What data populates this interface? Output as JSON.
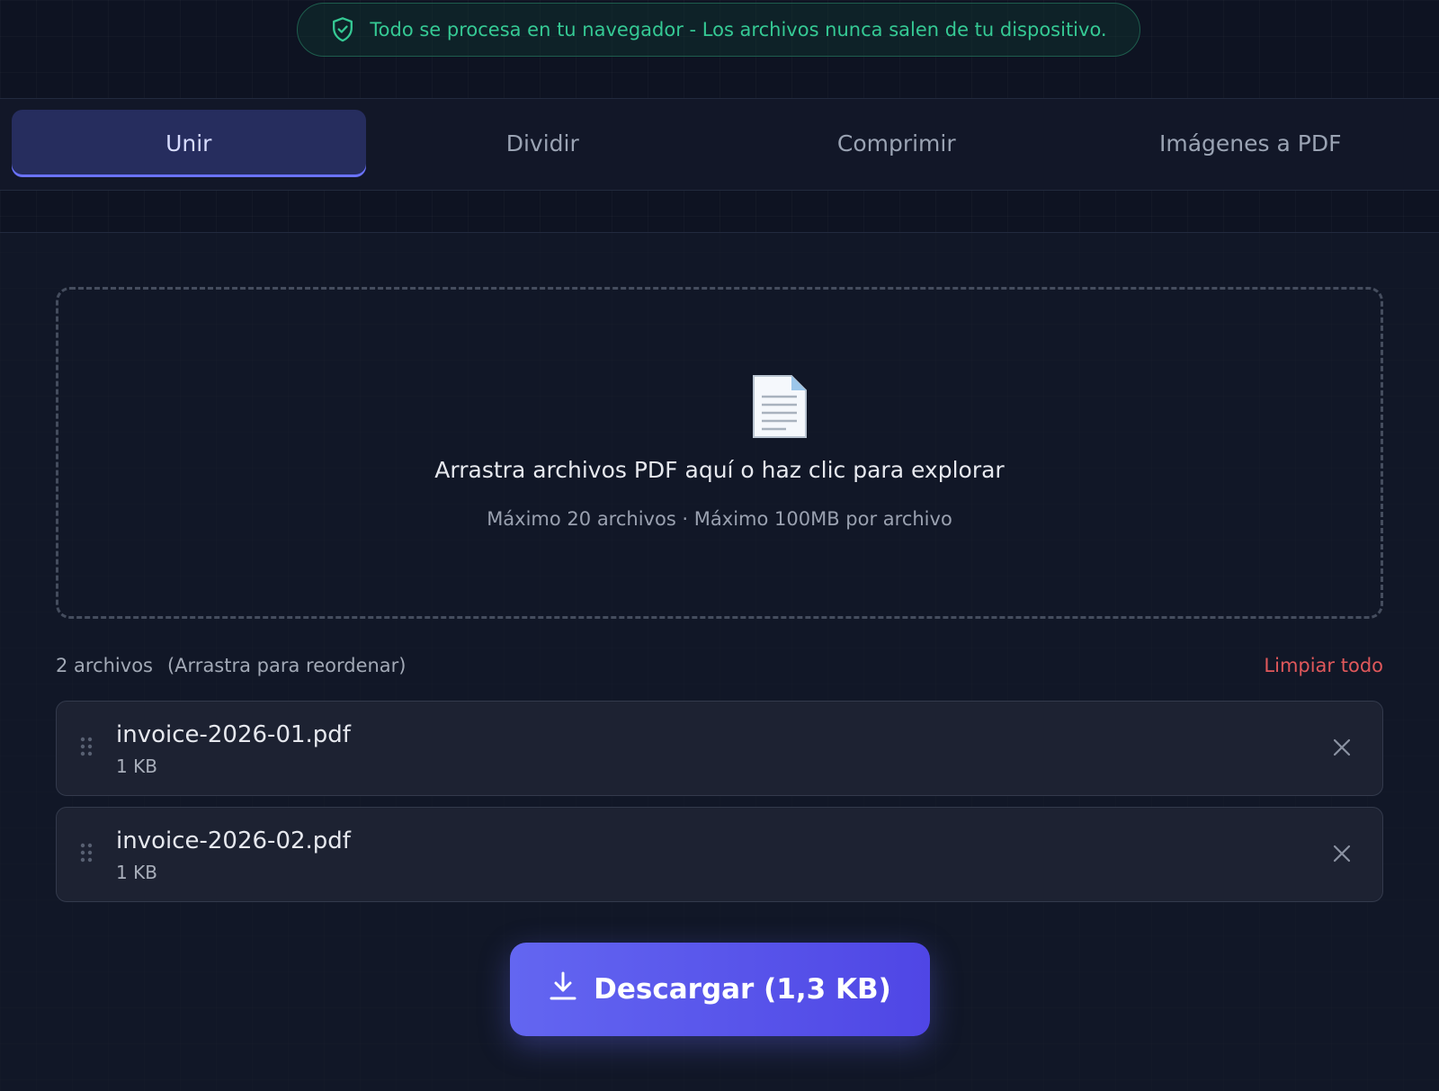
{
  "privacy": {
    "icon": "shield-check-icon",
    "text": "Todo se procesa en tu navegador - Los archivos nunca salen de tu dispositivo.",
    "color": "#35c994"
  },
  "tabs": [
    {
      "label": "Unir",
      "active": true
    },
    {
      "label": "Dividir",
      "active": false
    },
    {
      "label": "Comprimir",
      "active": false
    },
    {
      "label": "Imágenes a PDF",
      "active": false
    }
  ],
  "dropzone": {
    "icon": "document-icon",
    "title": "Arrastra archivos PDF aquí o haz clic para explorar",
    "subtitle": "Máximo 20 archivos · Máximo 100MB por archivo"
  },
  "file_list": {
    "count_label": "2 archivos",
    "hint": "(Arrastra para reordenar)",
    "clear_label": "Limpiar todo",
    "files": [
      {
        "name": "invoice-2026-01.pdf",
        "size": "1 KB"
      },
      {
        "name": "invoice-2026-02.pdf",
        "size": "1 KB"
      }
    ]
  },
  "download": {
    "icon": "download-icon",
    "label": "Descargar (1,3 KB)"
  },
  "colors": {
    "accent": "#6366f1",
    "danger": "#e0585b",
    "background": "#0e1322"
  }
}
